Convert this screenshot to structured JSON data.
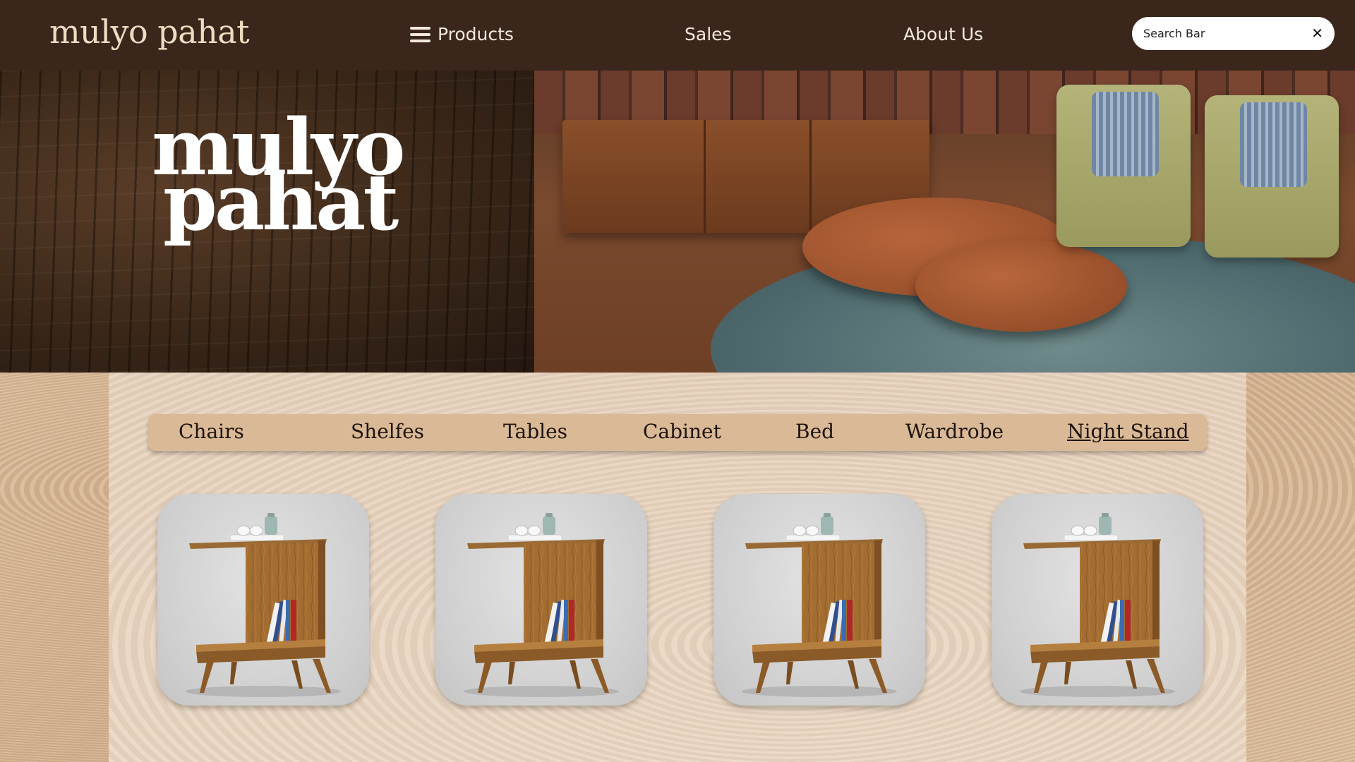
{
  "header": {
    "brand": "mulyo pahat",
    "nav": [
      {
        "label": "Products",
        "icon": "menu-icon"
      },
      {
        "label": "Sales"
      },
      {
        "label": "About Us"
      }
    ],
    "search": {
      "placeholder": "Search Bar",
      "value": "",
      "clear_icon": "close-icon"
    }
  },
  "hero": {
    "title_line1": "mulyo",
    "title_line2": "pahat"
  },
  "categories": [
    {
      "label": "Chairs",
      "active": false
    },
    {
      "label": "Shelfes",
      "active": false
    },
    {
      "label": "Tables",
      "active": false
    },
    {
      "label": "Cabinet",
      "active": false
    },
    {
      "label": "Bed",
      "active": false
    },
    {
      "label": "Wardrobe",
      "active": false
    },
    {
      "label": "Night Stand",
      "active": true
    }
  ],
  "products": [
    {
      "item": "night-stand"
    },
    {
      "item": "night-stand"
    },
    {
      "item": "night-stand"
    },
    {
      "item": "night-stand"
    }
  ],
  "colors": {
    "header_bg": "#3a261a",
    "brand_text": "#f1dcc3",
    "category_bar": "#d9b996"
  }
}
